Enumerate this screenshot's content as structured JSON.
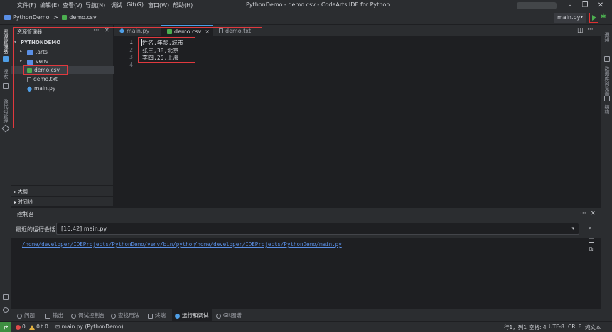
{
  "menu": [
    "文件(F)",
    "编辑(E)",
    "查看(V)",
    "导航(N)",
    "调试",
    "Git(G)",
    "窗口(W)",
    "帮助(H)"
  ],
  "window_title": "PythonDemo - demo.csv - CodeArts IDE for Python",
  "breadcrumb": {
    "project": "PythonDemo",
    "separator": ">",
    "file": "demo.csv"
  },
  "run_config": "main.py",
  "left_strip": {
    "explorer": "资源管理器",
    "search": "搜索",
    "source_control": "源代码管理"
  },
  "right_strip": {
    "a": "通知",
    "b": "数据库浏览器",
    "c": "结构"
  },
  "explorer": {
    "header": "资源管理器",
    "project": "PYTHONDEMO",
    "items": [
      {
        "label": ".arts",
        "kind": "folder"
      },
      {
        "label": "venv",
        "kind": "folder"
      },
      {
        "label": "demo.csv",
        "kind": "csv"
      },
      {
        "label": "demo.txt",
        "kind": "txt"
      },
      {
        "label": "main.py",
        "kind": "py"
      }
    ],
    "outline": "大纲",
    "timeline": "时间线"
  },
  "tabs": [
    {
      "label": "main.py"
    },
    {
      "label": "demo.csv",
      "close": "×"
    },
    {
      "label": "demo.txt"
    }
  ],
  "editor": {
    "lines": [
      {
        "num": "1",
        "text": "姓名,年龄,城市"
      },
      {
        "num": "2",
        "text": "张三,30,北京"
      },
      {
        "num": "3",
        "text": "李四,25,上海"
      },
      {
        "num": "4",
        "text": ""
      }
    ]
  },
  "console": {
    "title": "控制台",
    "session_label": "最近的运行会话",
    "session_value": "[16:42] main.py",
    "output": [
      "/home/developer/IDEProjects/PythonDemo/venv/bin/python",
      "/home/developer/IDEProjects/PythonDemo/main.py"
    ]
  },
  "bottom_tabs": [
    "问题",
    "输出",
    "调试控制台",
    "查找用法",
    "终端",
    "运行和调试",
    "Git图谱"
  ],
  "status": {
    "errors": "0",
    "warnings": "0",
    "problems_extra": "0",
    "run_item": "main.py (PythonDemo)",
    "position": "行1，列1",
    "spaces": "空格: 4",
    "encoding": "UTF-8",
    "eol": "CRLF",
    "lang": "纯文本"
  },
  "colors": {
    "accent": "#4e9ee6",
    "annotation": "#e0393e",
    "run_green": "#4caf50"
  }
}
